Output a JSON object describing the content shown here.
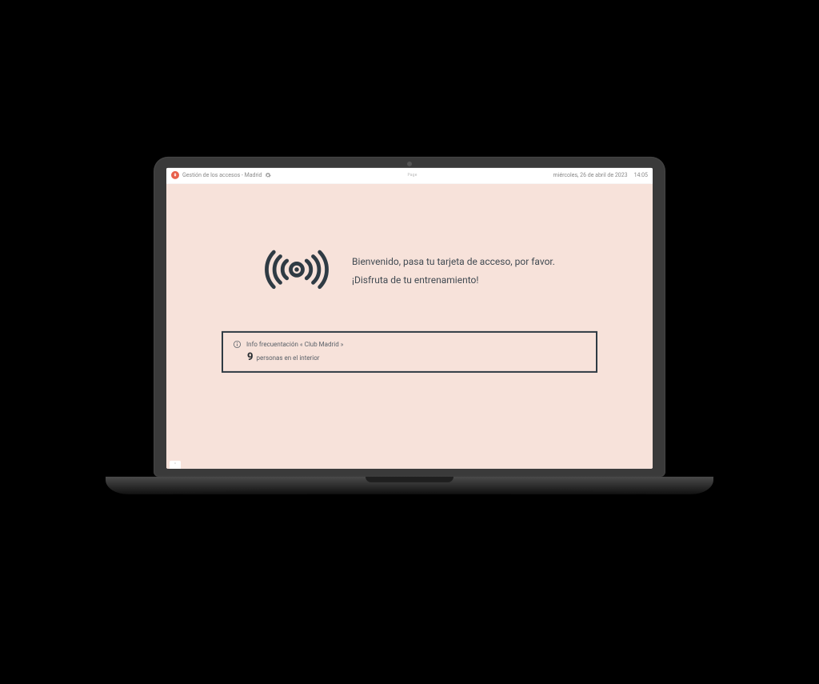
{
  "topbar": {
    "title": "Gestión de los accesos - Madrid",
    "center_label": "Page",
    "date_text": "miércoles, 26 de abril de 2023",
    "time_text": "14:05"
  },
  "welcome": {
    "line1": "Bienvenido, pasa tu tarjeta de acceso, por favor.",
    "line2": "¡Disfruta de tu entrenamiento!"
  },
  "occupancy": {
    "info_label": "Info frecuentación « Club Madrid »",
    "count": "9",
    "count_suffix": "personas en el interior"
  },
  "icons": {
    "brand": "rocket-icon",
    "gear": "gear-icon",
    "broadcast": "broadcast-icon",
    "info": "info-icon"
  },
  "colors": {
    "accent": "#e8604c",
    "panel_bg": "#f7e2da",
    "border_dark": "#2f3b44"
  }
}
